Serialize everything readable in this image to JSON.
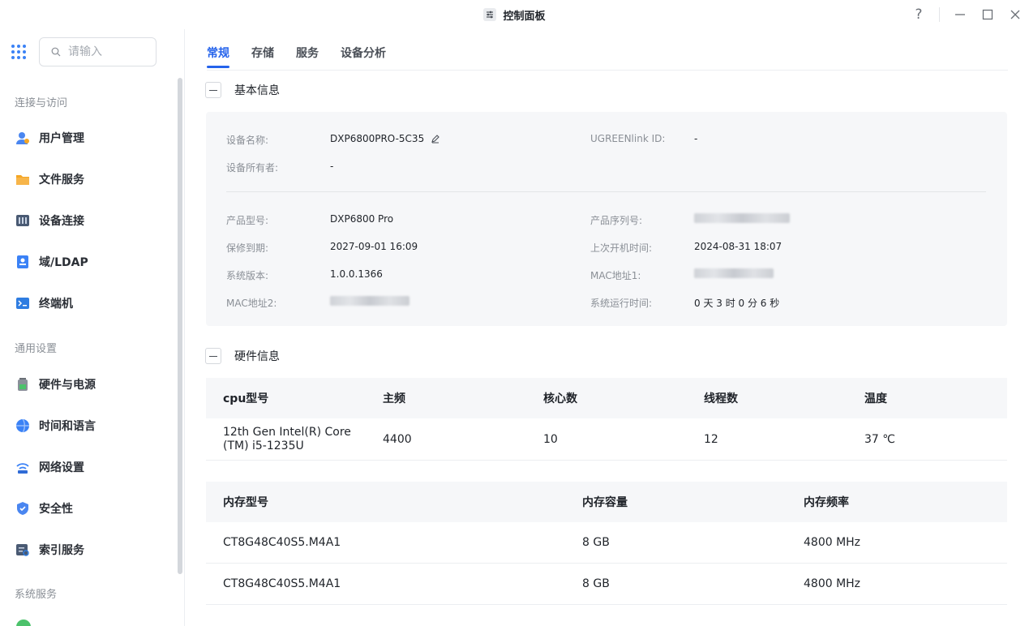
{
  "window": {
    "title": "控制面板",
    "help_label": "?",
    "minimize_label": "—",
    "maximize_label": "☐",
    "close_label": "✕"
  },
  "sidebar": {
    "search_placeholder": "请输入",
    "groups": [
      {
        "title": "连接与访问",
        "items": [
          {
            "label": "用户管理",
            "icon": "user-icon"
          },
          {
            "label": "文件服务",
            "icon": "folder-icon"
          },
          {
            "label": "设备连接",
            "icon": "device-icon"
          },
          {
            "label": "域/LDAP",
            "icon": "ldap-icon"
          },
          {
            "label": "终端机",
            "icon": "terminal-icon"
          }
        ]
      },
      {
        "title": "通用设置",
        "items": [
          {
            "label": "硬件与电源",
            "icon": "battery-icon"
          },
          {
            "label": "时间和语言",
            "icon": "globe-icon"
          },
          {
            "label": "网络设置",
            "icon": "wifi-icon"
          },
          {
            "label": "安全性",
            "icon": "shield-icon"
          },
          {
            "label": "索引服务",
            "icon": "index-icon"
          }
        ]
      },
      {
        "title": "系统服务",
        "items": []
      }
    ]
  },
  "tabs": [
    "常规",
    "存储",
    "服务",
    "设备分析"
  ],
  "basic": {
    "title": "基本信息",
    "device_name_label": "设备名称:",
    "device_name": "DXP6800PRO-5C35",
    "ugreen_label": "UGREENlink ID:",
    "ugreen_value": "-",
    "owner_label": "设备所有者:",
    "owner_value": "-",
    "model_label": "产品型号:",
    "model_value": "DXP6800 Pro",
    "serial_label": "产品序列号:",
    "warranty_label": "保修到期:",
    "warranty_value": "2027-09-01 16:09",
    "boot_label": "上次开机时间:",
    "boot_value": "2024-08-31 18:07",
    "version_label": "系统版本:",
    "version_value": "1.0.0.1366",
    "mac1_label": "MAC地址1:",
    "mac2_label": "MAC地址2:",
    "uptime_label": "系统运行时间:",
    "uptime_value": "0 天 3 时 0 分 6 秒"
  },
  "hardware": {
    "title": "硬件信息",
    "cpu_headers": [
      "cpu型号",
      "主频",
      "核心数",
      "线程数",
      "温度"
    ],
    "cpu_row": [
      "12th Gen Intel(R) Core (TM) i5-1235U",
      "4400",
      "10",
      "12",
      "37 ℃"
    ],
    "mem_headers": [
      "内存型号",
      "内存容量",
      "内存频率"
    ],
    "mem_rows": [
      [
        "CT8G48C40S5.M4A1",
        "8 GB",
        "4800 MHz"
      ],
      [
        "CT8G48C40S5.M4A1",
        "8 GB",
        "4800 MHz"
      ]
    ]
  },
  "colors": {
    "accent": "#2563eb",
    "panel": "#f6f7f9"
  }
}
